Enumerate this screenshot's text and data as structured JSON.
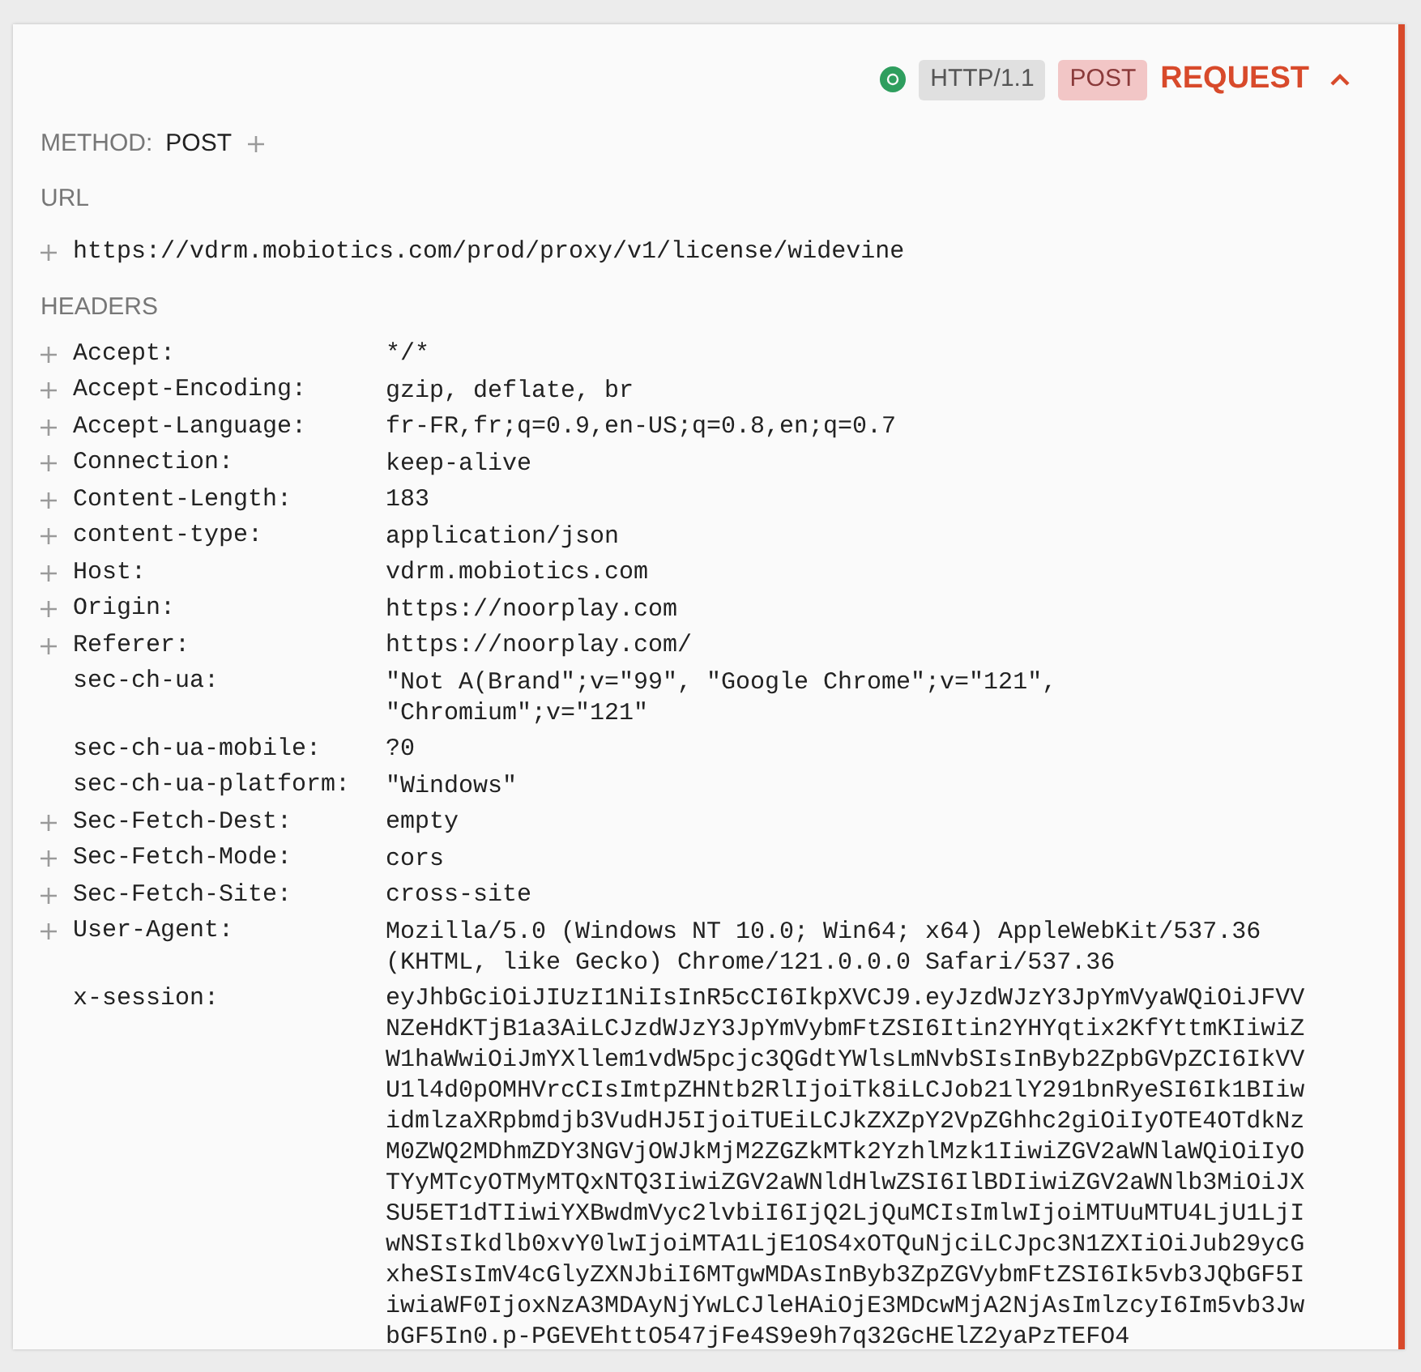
{
  "header": {
    "protocol": "HTTP/1.1",
    "method_badge": "POST",
    "title": "REQUEST",
    "expanded": true
  },
  "method": {
    "label": "METHOD:",
    "value": "POST"
  },
  "url": {
    "label": "URL",
    "value": "https://vdrm.mobiotics.com/prod/proxy/v1/license/widevine"
  },
  "headers": {
    "label": "HEADERS",
    "rows": [
      {
        "name": "Accept:",
        "value": "*/*",
        "addable": true
      },
      {
        "name": "Accept-Encoding:",
        "value": "gzip, deflate, br",
        "addable": true
      },
      {
        "name": "Accept-Language:",
        "value": "fr-FR,fr;q=0.9,en-US;q=0.8,en;q=0.7",
        "addable": true
      },
      {
        "name": "Connection:",
        "value": "keep-alive",
        "addable": true
      },
      {
        "name": "Content-Length:",
        "value": "183",
        "addable": true
      },
      {
        "name": "content-type:",
        "value": "application/json",
        "addable": true
      },
      {
        "name": "Host:",
        "value": "vdrm.mobiotics.com",
        "addable": true
      },
      {
        "name": "Origin:",
        "value": "https://noorplay.com",
        "addable": true
      },
      {
        "name": "Referer:",
        "value": "https://noorplay.com/",
        "addable": true
      },
      {
        "name": "sec-ch-ua:",
        "value": "\"Not A(Brand\";v=\"99\", \"Google Chrome\";v=\"121\", \"Chromium\";v=\"121\"",
        "addable": false
      },
      {
        "name": "sec-ch-ua-mobile:",
        "value": "?0",
        "addable": false
      },
      {
        "name": "sec-ch-ua-platform:",
        "value": "\"Windows\"",
        "addable": false
      },
      {
        "name": "Sec-Fetch-Dest:",
        "value": "empty",
        "addable": true
      },
      {
        "name": "Sec-Fetch-Mode:",
        "value": "cors",
        "addable": true
      },
      {
        "name": "Sec-Fetch-Site:",
        "value": "cross-site",
        "addable": true
      },
      {
        "name": "User-Agent:",
        "value": "Mozilla/5.0 (Windows NT 10.0; Win64; x64) AppleWebKit/537.36 (KHTML, like Gecko) Chrome/121.0.0.0 Safari/537.36",
        "addable": true
      },
      {
        "name": "x-session:",
        "value": "eyJhbGciOiJIUzI1NiIsInR5cCI6IkpXVCJ9.eyJzdWJzY3JpYmVyaWQiOiJFVVNZeHdKTjB1a3AiLCJzdWJzY3JpYmVybmFtZSI6Itin2YHYqtix2KfYttmKIiwiZW1haWwiOiJmYXllem1vdW5pcjc3QGdtYWlsLmNvbSIsInByb2ZpbGVpZCI6IkVVU1l4d0pOMHVrcCIsImtpZHNtb2RlIjoiTk8iLCJob21lY291bnRyeSI6Ik1BIiwidmlzaXRpbmdjb3VudHJ5IjoiTUEiLCJkZXZpY2VpZGhhc2giOiIyOTE4OTdkNzM0ZWQ2MDhmZDY3NGVjOWJkMjM2ZGZkMTk2YzhlMzk1IiwiZGV2aWNlaWQiOiIyOTYyMTcyOTMyMTQxNTQ3IiwiZGV2aWNldHlwZSI6IlBDIiwiZGV2aWNlb3MiOiJXSU5ET1dTIiwiYXBwdmVyc2lvbiI6IjQ2LjQuMCIsImlwIjoiMTUuMTU4LjU1LjIwNSIsIkdlb0xvY0lwIjoiMTA1LjE1OS4xOTQuNjciLCJpc3N1ZXIiOiJub29ycGxheSIsImV4cGlyZXNJbiI6MTgwMDAsInByb3ZpZGVybmFtZSI6Ik5vb3JQbGF5IiwiaWF0IjoxNzA3MDAyNjYwLCJleHAiOjE3MDcwMjA2NjAsImlzcyI6Im5vb3JwbGF5In0.p-PGEVEhttO547jFe4S9e9h7q32GcHElZ2yaPzTEFO4",
        "addable": false
      }
    ]
  }
}
